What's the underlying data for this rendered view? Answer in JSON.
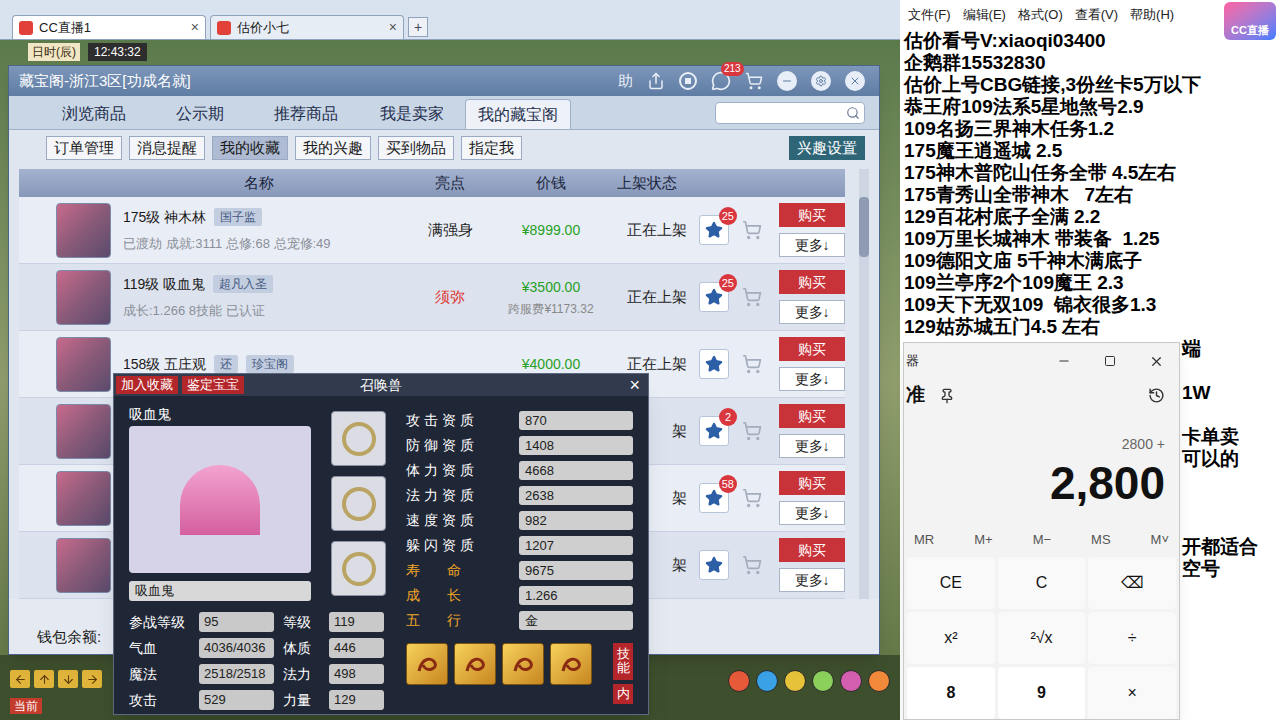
{
  "browser": {
    "tabs": [
      {
        "label": "CC直播1",
        "selected": true,
        "close": "×"
      },
      {
        "label": "估价小七",
        "selected": false,
        "close": "×"
      }
    ],
    "new_tab": "+"
  },
  "game": {
    "clock_label": "日时(辰)",
    "clock": "12:43:32",
    "channel_button": "当前"
  },
  "cbg": {
    "title": "藏宝阁-浙江3区[功成名就]",
    "help": "助",
    "message_badge": "213",
    "tabs": [
      {
        "label": "浏览商品",
        "selected": false
      },
      {
        "label": "公示期",
        "selected": false
      },
      {
        "label": "推荐商品",
        "selected": false
      },
      {
        "label": "我是卖家",
        "selected": false
      },
      {
        "label": "我的藏宝阁",
        "selected": true
      }
    ],
    "subtabs": [
      {
        "label": "订单管理",
        "selected": false
      },
      {
        "label": "消息提醒",
        "selected": false
      },
      {
        "label": "我的收藏",
        "selected": true
      },
      {
        "label": "我的兴趣",
        "selected": false
      },
      {
        "label": "买到物品",
        "selected": false
      },
      {
        "label": "指定我",
        "selected": false
      }
    ],
    "interest_button": "兴趣设置",
    "columns": [
      "名称",
      "亮点",
      "价钱",
      "上架状态"
    ],
    "rows": [
      {
        "name": "175级 神木林",
        "tags": [
          "国子监"
        ],
        "detail": "已渡劫 成就:3111 总修:68 总宠修:49",
        "highlight": "满强身",
        "highlight_color": "#222222",
        "price": "¥8999.00",
        "fee": "",
        "status": "正在上架",
        "favorites": "25",
        "buy": "购买",
        "more": "更多↓"
      },
      {
        "name": "119级 吸血鬼",
        "tags": [
          "超凡入圣"
        ],
        "detail": "成长:1.266 8技能 已认证",
        "highlight": "须弥",
        "highlight_color": "#e0312b",
        "price": "¥3500.00",
        "fee": "跨服费¥1173.32",
        "status": "正在上架",
        "favorites": "25",
        "buy": "购买",
        "more": "更多↓"
      },
      {
        "name": "158级 五庄观",
        "tags": [
          "还",
          "珍宝阁"
        ],
        "detail": "",
        "highlight": "",
        "highlight_color": "#222222",
        "price": "¥4000.00",
        "fee": "",
        "status": "正在上架",
        "favorites": "",
        "buy": "购买",
        "more": "更多↓"
      },
      {
        "name": "",
        "tags": [],
        "detail": "",
        "highlight": "",
        "highlight_color": "#222222",
        "price": "",
        "fee": "",
        "status": "架",
        "favorites": "2",
        "buy": "购买",
        "more": "更多↓"
      },
      {
        "name": "",
        "tags": [],
        "detail": "",
        "highlight": "",
        "highlight_color": "#222222",
        "price": "",
        "fee": "",
        "status": "架",
        "favorites": "58",
        "buy": "购买",
        "more": "更多↓"
      },
      {
        "name": "",
        "tags": [],
        "detail": "",
        "highlight": "",
        "highlight_color": "#222222",
        "price": "",
        "fee": "",
        "status": "架",
        "favorites": "",
        "buy": "购买",
        "more": "更多↓"
      }
    ],
    "wallet_label": "钱包余额:"
  },
  "pet_panel": {
    "add_favorite": "加入收藏",
    "appraise": "鉴定宝宝",
    "title": "召唤兽",
    "close": "×",
    "name": "吸血鬼",
    "name_field": "吸血鬼",
    "attributes": [
      {
        "label": "参战等级",
        "value": "95",
        "label2": "等级",
        "value2": "119"
      },
      {
        "label": "气血",
        "value": "4036/4036",
        "label2": "体质",
        "value2": "446"
      },
      {
        "label": "魔法",
        "value": "2518/2518",
        "label2": "法力",
        "value2": "498"
      },
      {
        "label": "攻击",
        "value": "529",
        "label2": "力量",
        "value2": "129"
      }
    ],
    "aptitudes": [
      {
        "label": "攻 击 资 质",
        "value": "870",
        "color": "#ffffff"
      },
      {
        "label": "防 御 资 质",
        "value": "1408",
        "color": "#ffffff"
      },
      {
        "label": "体 力 资 质",
        "value": "4668",
        "color": "#ffffff"
      },
      {
        "label": "法 力 资 质",
        "value": "2638",
        "color": "#ffffff"
      },
      {
        "label": "速 度 资 质",
        "value": "982",
        "color": "#ffffff"
      },
      {
        "label": "躲 闪 资 质",
        "value": "1207",
        "color": "#ffffff"
      },
      {
        "label": "寿       命",
        "value": "9675",
        "color": "#f0a526"
      },
      {
        "label": "成       长",
        "value": "1.266",
        "color": "#f0a526"
      },
      {
        "label": "五       行",
        "value": "金",
        "color": "#f0a526"
      }
    ],
    "skills_tab": "技能",
    "inner_tab": "内"
  },
  "notepad": {
    "menu": [
      "文件(F)",
      "编辑(E)",
      "格式(O)",
      "查看(V)",
      "帮助(H)"
    ],
    "lines": [
      {
        "text": "估价看号V:xiaoqi03400",
        "kind": "full"
      },
      {
        "text": "企鹅群15532830",
        "kind": "full"
      },
      {
        "text": "估价上号CBG链接,3份丝卡5万以下",
        "kind": "full"
      },
      {
        "text": "恭王府109法系5星地煞号2.9",
        "kind": "full"
      },
      {
        "text": "109名扬三界神木任务1.2",
        "kind": "full"
      },
      {
        "text": "175魔王逍遥城 2.5",
        "kind": "full"
      },
      {
        "text": "175神木普陀山任务全带 4.5左右",
        "kind": "full"
      },
      {
        "text": "175青秀山全带神木   7左右",
        "kind": "full"
      },
      {
        "text": "129百花村底子全满 2.2",
        "kind": "full"
      },
      {
        "text": "109万里长城神木 带装备  1.25",
        "kind": "full"
      },
      {
        "text": "109德阳文庙 5千神木满底子",
        "kind": "full"
      },
      {
        "text": "109兰亭序2个109魔王 2.3",
        "kind": "full"
      },
      {
        "text": "109天下无双109  锦衣很多1.3",
        "kind": "full"
      },
      {
        "text": "129姑苏城五门4.5 左右",
        "kind": "full"
      },
      {
        "text": "端",
        "kind": "tail"
      },
      {
        "text": "",
        "kind": "tail"
      },
      {
        "text": "1W",
        "kind": "tail"
      },
      {
        "text": "",
        "kind": "tail"
      },
      {
        "text": "卡单卖",
        "kind": "tail"
      },
      {
        "text": "可以的",
        "kind": "tail"
      },
      {
        "text": "",
        "kind": "tail"
      },
      {
        "text": "",
        "kind": "tail"
      },
      {
        "text": "",
        "kind": "tail"
      },
      {
        "text": "开都适合",
        "kind": "tail"
      },
      {
        "text": "空号",
        "kind": "tail"
      }
    ]
  },
  "calculator": {
    "title": "器",
    "mode": "准",
    "expression": "2800 +",
    "value": "2,800",
    "memory": [
      "MR",
      "M+",
      "M−",
      "MS",
      "M˅"
    ],
    "keys": [
      {
        "label": "CE",
        "kind": "op"
      },
      {
        "label": "C",
        "kind": "op"
      },
      {
        "label": "⌫",
        "kind": "op"
      },
      {
        "label": "x²",
        "kind": "op"
      },
      {
        "label": "²√x",
        "kind": "op"
      },
      {
        "label": "÷",
        "kind": "op"
      },
      {
        "label": "8",
        "kind": "digit"
      },
      {
        "label": "9",
        "kind": "digit"
      },
      {
        "label": "×",
        "kind": "op"
      }
    ]
  },
  "logo": "CC直播"
}
